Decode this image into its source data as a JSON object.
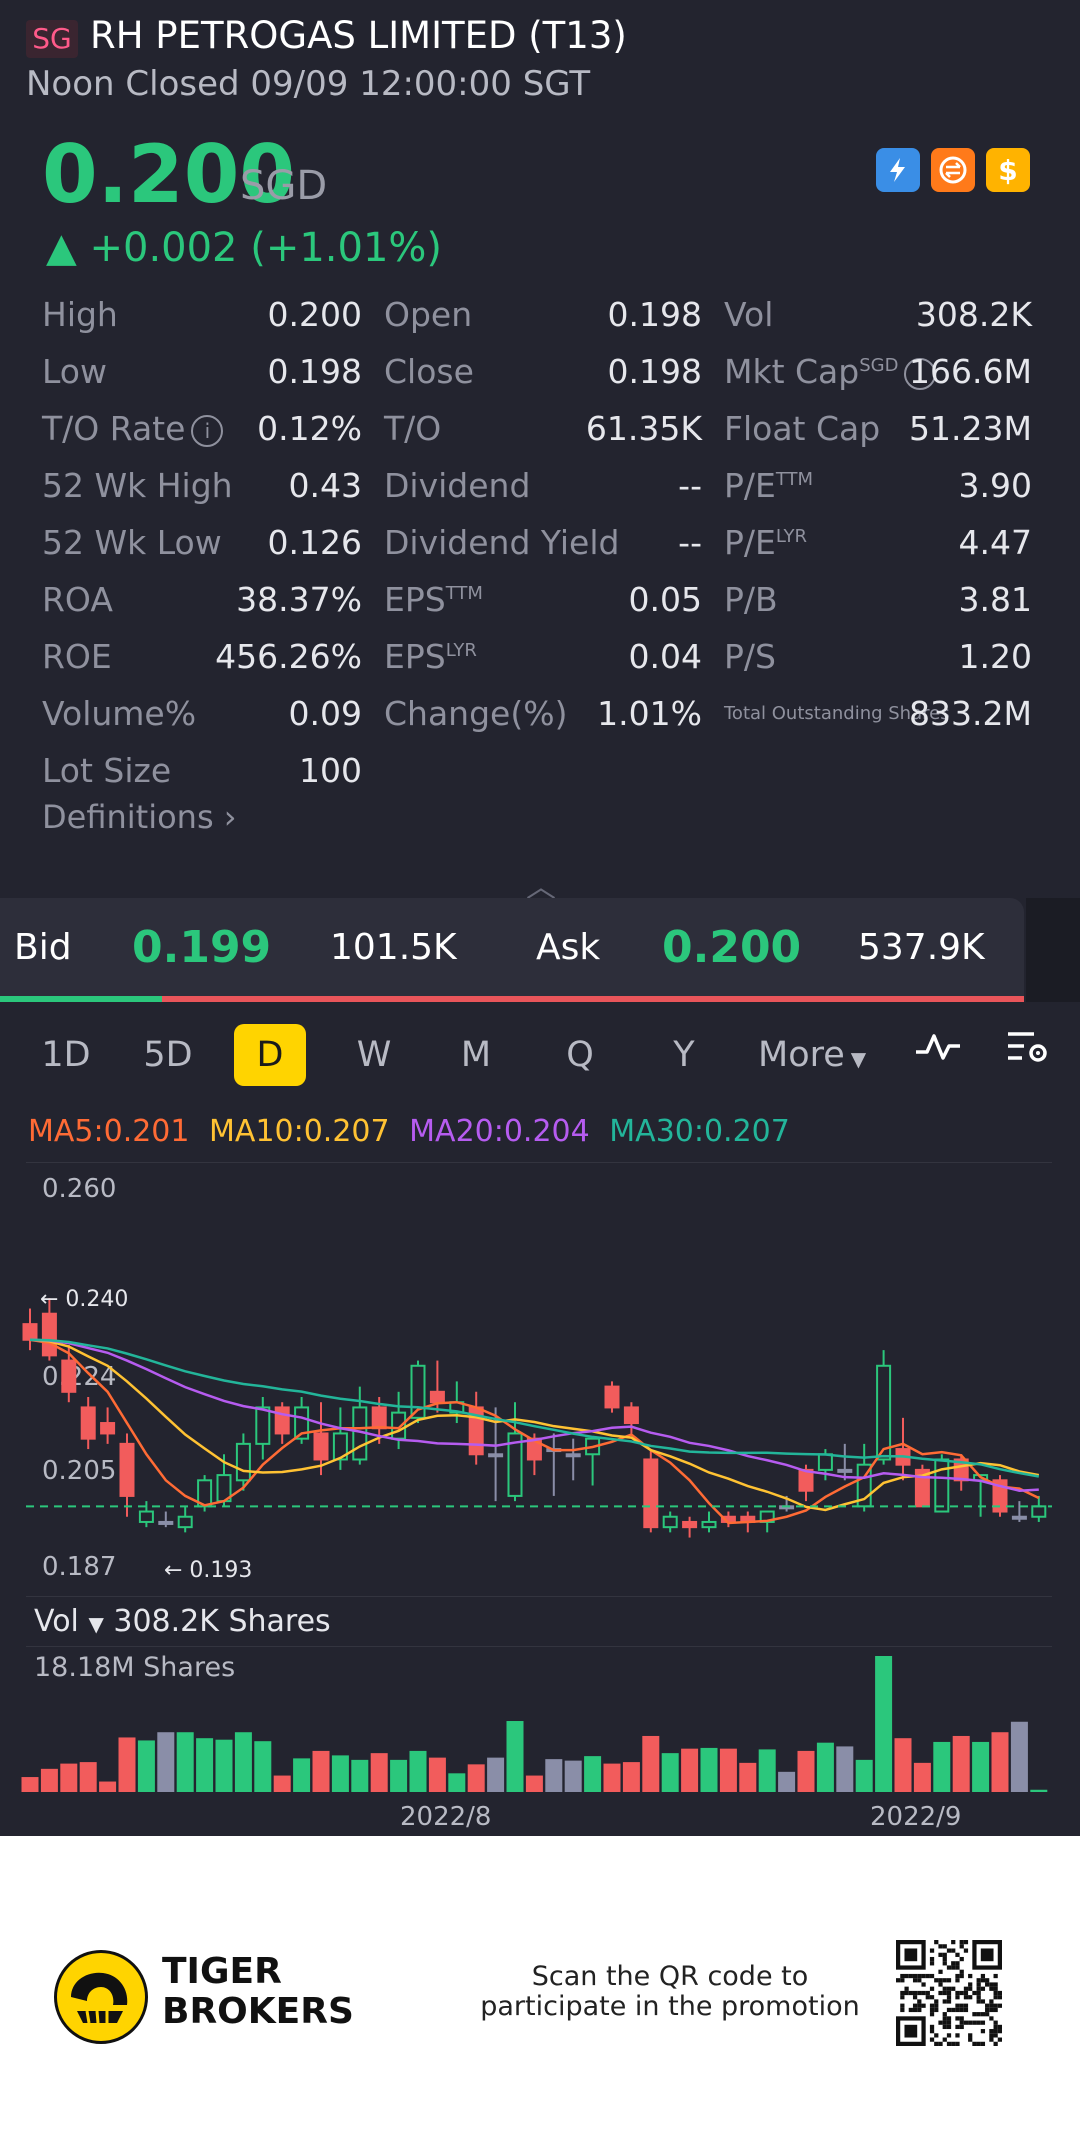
{
  "header": {
    "market_badge": "SG",
    "title": "RH PETROGAS LIMITED (T13)",
    "subtitle": "Noon Closed 09/09 12:00:00 SGT"
  },
  "quote": {
    "price": "0.200",
    "currency": "SGD",
    "change": "▲ +0.002 (+1.01%)",
    "price_color": "#2bc77c"
  },
  "badges": [
    {
      "icon": "lightning-icon",
      "color": "#3a8ee6"
    },
    {
      "icon": "swap-icon",
      "color": "#ff7a1a"
    },
    {
      "icon": "dollar-icon",
      "color": "#ffb300",
      "text": "$"
    }
  ],
  "stats": {
    "high_label": "High",
    "high": "0.200",
    "open_label": "Open",
    "open": "0.198",
    "vol_label": "Vol",
    "vol": "308.2K",
    "low_label": "Low",
    "low": "0.198",
    "close_label": "Close",
    "close": "0.198",
    "mktcap_label": "Mkt Cap",
    "mktcap_sup": "SGD",
    "mktcap": "166.6M",
    "to_rate_label": "T/O Rate",
    "to_rate": "0.12%",
    "to_label": "T/O",
    "to": "61.35K",
    "float_cap_label": "Float Cap",
    "float_cap": "51.23M",
    "wk52_high_label": "52 Wk High",
    "wk52_high": "0.43",
    "dividend_label": "Dividend",
    "dividend": "--",
    "pe_ttm_label": "P/E",
    "pe_ttm_sup": "TTM",
    "pe_ttm": "3.90",
    "wk52_low_label": "52 Wk Low",
    "wk52_low": "0.126",
    "div_yield_label": "Dividend Yield",
    "div_yield": "--",
    "pe_lyr_label": "P/E",
    "pe_lyr_sup": "LYR",
    "pe_lyr": "4.47",
    "roa_label": "ROA",
    "roa": "38.37%",
    "eps_ttm_label": "EPS",
    "eps_ttm_sup": "TTM",
    "eps_ttm": "0.05",
    "pb_label": "P/B",
    "pb": "3.81",
    "roe_label": "ROE",
    "roe": "456.26%",
    "eps_lyr_label": "EPS",
    "eps_lyr_sup": "LYR",
    "eps_lyr": "0.04",
    "ps_label": "P/S",
    "ps": "1.20",
    "volume_pct_label": "Volume%",
    "volume_pct": "0.09",
    "change_pct_label": "Change(%)",
    "change_pct": "1.01%",
    "tos_label": "Total Outstanding Shares",
    "tos": "833.2M",
    "lot_size_label": "Lot Size",
    "lot_size": "100",
    "definitions": "Definitions"
  },
  "orderbook": {
    "bid_label": "Bid",
    "bid_price": "0.199",
    "bid_size": "101.5K",
    "ask_label": "Ask",
    "ask_price": "0.200",
    "ask_size": "537.9K"
  },
  "tabs": [
    "1D",
    "5D",
    "D",
    "W",
    "M",
    "Q",
    "Y",
    "More"
  ],
  "active_tab": "D",
  "chart_data": {
    "type": "candlestick",
    "moving_averages": [
      {
        "name": "MA5",
        "value": "0.201",
        "color": "#ff6b35",
        "label": "MA5:0.201"
      },
      {
        "name": "MA10",
        "value": "0.207",
        "color": "#ffc233",
        "label": "MA10:0.207"
      },
      {
        "name": "MA20",
        "value": "0.204",
        "color": "#b65cf0",
        "label": "MA20:0.204"
      },
      {
        "name": "MA30",
        "value": "0.207",
        "color": "#23b59a",
        "label": "MA30:0.207"
      }
    ],
    "y_ticks": [
      "0.260",
      "0.224",
      "0.205",
      "0.187"
    ],
    "ylim": [
      0.187,
      0.26
    ],
    "high_marker": "0.240",
    "low_marker": "0.193",
    "last_close": 0.2,
    "x_labels": [
      "2022/8",
      "2022/9"
    ],
    "volume_label": "Vol",
    "volume_value": "308.2K Shares",
    "volume_max": "18.18M Shares",
    "up_color": "#2bc77c",
    "down_color": "#f25c5c",
    "flat_color": "#8a8ea8",
    "candles": [
      {
        "o": 0.235,
        "c": 0.232,
        "h": 0.238,
        "l": 0.23,
        "v": 2.0
      },
      {
        "o": 0.237,
        "c": 0.229,
        "h": 0.24,
        "l": 0.228,
        "v": 3.1
      },
      {
        "o": 0.228,
        "c": 0.222,
        "h": 0.231,
        "l": 0.22,
        "v": 3.8
      },
      {
        "o": 0.219,
        "c": 0.213,
        "h": 0.221,
        "l": 0.211,
        "v": 4.0
      },
      {
        "o": 0.216,
        "c": 0.214,
        "h": 0.219,
        "l": 0.212,
        "v": 1.4
      },
      {
        "o": 0.212,
        "c": 0.202,
        "h": 0.214,
        "l": 0.198,
        "v": 7.3
      },
      {
        "o": 0.197,
        "c": 0.199,
        "h": 0.201,
        "l": 0.196,
        "v": 6.9
      },
      {
        "o": 0.197,
        "c": 0.197,
        "h": 0.199,
        "l": 0.196,
        "v": 8.0
      },
      {
        "o": 0.196,
        "c": 0.198,
        "h": 0.2,
        "l": 0.195,
        "v": 8.0
      },
      {
        "o": 0.2,
        "c": 0.205,
        "h": 0.206,
        "l": 0.199,
        "v": 7.2
      },
      {
        "o": 0.201,
        "c": 0.206,
        "h": 0.21,
        "l": 0.2,
        "v": 7.0
      },
      {
        "o": 0.205,
        "c": 0.212,
        "h": 0.214,
        "l": 0.203,
        "v": 8.0
      },
      {
        "o": 0.212,
        "c": 0.219,
        "h": 0.221,
        "l": 0.209,
        "v": 6.8
      },
      {
        "o": 0.219,
        "c": 0.214,
        "h": 0.22,
        "l": 0.212,
        "v": 2.2
      },
      {
        "o": 0.213,
        "c": 0.219,
        "h": 0.221,
        "l": 0.212,
        "v": 4.5
      },
      {
        "o": 0.214,
        "c": 0.209,
        "h": 0.22,
        "l": 0.206,
        "v": 5.5
      },
      {
        "o": 0.209,
        "c": 0.214,
        "h": 0.219,
        "l": 0.207,
        "v": 4.9
      },
      {
        "o": 0.209,
        "c": 0.219,
        "h": 0.223,
        "l": 0.208,
        "v": 4.3
      },
      {
        "o": 0.219,
        "c": 0.215,
        "h": 0.221,
        "l": 0.212,
        "v": 5.2
      },
      {
        "o": 0.213,
        "c": 0.218,
        "h": 0.222,
        "l": 0.211,
        "v": 4.3
      },
      {
        "o": 0.217,
        "c": 0.227,
        "h": 0.228,
        "l": 0.216,
        "v": 5.5
      },
      {
        "o": 0.222,
        "c": 0.22,
        "h": 0.228,
        "l": 0.218,
        "v": 4.6
      },
      {
        "o": 0.218,
        "c": 0.22,
        "h": 0.224,
        "l": 0.216,
        "v": 2.5
      },
      {
        "o": 0.219,
        "c": 0.21,
        "h": 0.222,
        "l": 0.208,
        "v": 3.7
      },
      {
        "o": 0.21,
        "c": 0.21,
        "h": 0.219,
        "l": 0.201,
        "v": 4.6
      },
      {
        "o": 0.202,
        "c": 0.214,
        "h": 0.22,
        "l": 0.201,
        "v": 9.5
      },
      {
        "o": 0.213,
        "c": 0.209,
        "h": 0.214,
        "l": 0.206,
        "v": 2.2
      },
      {
        "o": 0.211,
        "c": 0.211,
        "h": 0.214,
        "l": 0.202,
        "v": 4.4
      },
      {
        "o": 0.21,
        "c": 0.21,
        "h": 0.213,
        "l": 0.205,
        "v": 4.2
      },
      {
        "o": 0.21,
        "c": 0.213,
        "h": 0.213,
        "l": 0.204,
        "v": 4.8
      },
      {
        "o": 0.223,
        "c": 0.219,
        "h": 0.224,
        "l": 0.218,
        "v": 3.8
      },
      {
        "o": 0.219,
        "c": 0.216,
        "h": 0.22,
        "l": 0.214,
        "v": 4.0
      },
      {
        "o": 0.209,
        "c": 0.196,
        "h": 0.211,
        "l": 0.195,
        "v": 7.5
      },
      {
        "o": 0.196,
        "c": 0.198,
        "h": 0.199,
        "l": 0.195,
        "v": 5.2
      },
      {
        "o": 0.197,
        "c": 0.196,
        "h": 0.198,
        "l": 0.194,
        "v": 5.8
      },
      {
        "o": 0.196,
        "c": 0.197,
        "h": 0.199,
        "l": 0.195,
        "v": 5.9
      },
      {
        "o": 0.198,
        "c": 0.197,
        "h": 0.199,
        "l": 0.196,
        "v": 5.8
      },
      {
        "o": 0.198,
        "c": 0.197,
        "h": 0.199,
        "l": 0.195,
        "v": 3.9
      },
      {
        "o": 0.197,
        "c": 0.199,
        "h": 0.199,
        "l": 0.195,
        "v": 5.7
      },
      {
        "o": 0.2,
        "c": 0.2,
        "h": 0.202,
        "l": 0.199,
        "v": 2.7
      },
      {
        "o": 0.207,
        "c": 0.203,
        "h": 0.208,
        "l": 0.201,
        "v": 5.5
      },
      {
        "o": 0.207,
        "c": 0.21,
        "h": 0.211,
        "l": 0.205,
        "v": 6.6
      },
      {
        "o": 0.207,
        "c": 0.207,
        "h": 0.212,
        "l": 0.205,
        "v": 6.1
      },
      {
        "o": 0.2,
        "c": 0.208,
        "h": 0.212,
        "l": 0.199,
        "v": 4.3
      },
      {
        "o": 0.209,
        "c": 0.227,
        "h": 0.23,
        "l": 0.208,
        "v": 18.2
      },
      {
        "o": 0.211,
        "c": 0.208,
        "h": 0.217,
        "l": 0.205,
        "v": 7.2
      },
      {
        "o": 0.207,
        "c": 0.2,
        "h": 0.208,
        "l": 0.2,
        "v": 3.9
      },
      {
        "o": 0.199,
        "c": 0.209,
        "h": 0.21,
        "l": 0.199,
        "v": 6.7
      },
      {
        "o": 0.209,
        "c": 0.205,
        "h": 0.21,
        "l": 0.203,
        "v": 7.5
      },
      {
        "o": 0.205,
        "c": 0.206,
        "h": 0.206,
        "l": 0.198,
        "v": 6.7
      },
      {
        "o": 0.205,
        "c": 0.199,
        "h": 0.206,
        "l": 0.198,
        "v": 8.0
      },
      {
        "o": 0.198,
        "c": 0.198,
        "h": 0.201,
        "l": 0.197,
        "v": 9.4
      },
      {
        "o": 0.198,
        "c": 0.2,
        "h": 0.202,
        "l": 0.197,
        "v": 0.3
      }
    ]
  },
  "footer": {
    "brand_line1": "TIGER",
    "brand_line2": "BROKERS",
    "scan_line1": "Scan the QR code to",
    "scan_line2": "participate in the promotion"
  }
}
